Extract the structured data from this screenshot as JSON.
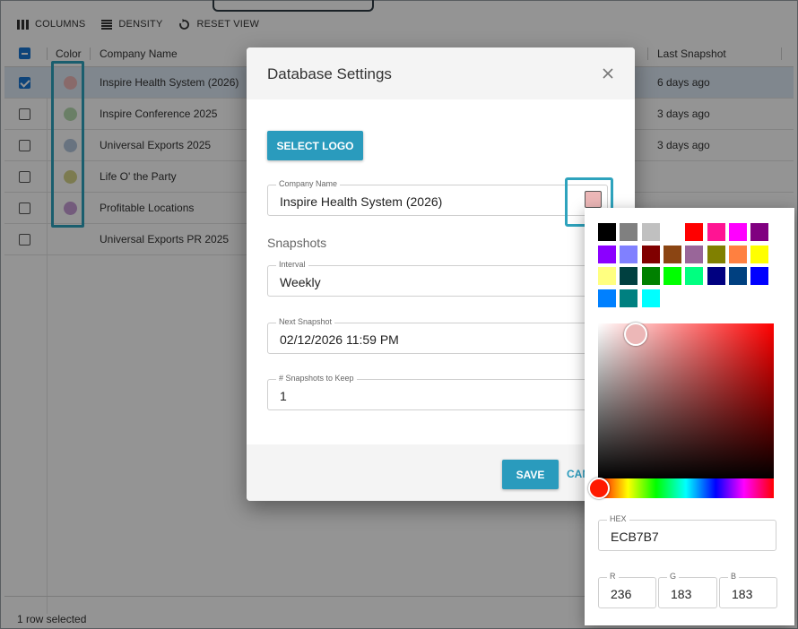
{
  "toolbar": {
    "columns_label": "COLUMNS",
    "density_label": "DENSITY",
    "reset_view_label": "RESET VIEW"
  },
  "grid": {
    "headers": {
      "color": "Color",
      "company_name": "Company Name",
      "last_snapshot": "Last Snapshot"
    },
    "rows": [
      {
        "name": "Inspire Health System (2026)",
        "color": "#ecb7b7",
        "last_snapshot": "6 days ago",
        "selected": true
      },
      {
        "name": "Inspire Conference 2025",
        "color": "#b7dbb0",
        "last_snapshot": "3 days ago",
        "selected": false
      },
      {
        "name": "Universal Exports 2025",
        "color": "#b4c6dc",
        "last_snapshot": "3 days ago",
        "selected": false
      },
      {
        "name": "Life O' the Party",
        "color": "#d6d48a",
        "last_snapshot": "",
        "selected": false
      },
      {
        "name": "Profitable Locations",
        "color": "#c79ed6",
        "last_snapshot": "",
        "selected": false
      },
      {
        "name": "Universal Exports PR 2025",
        "color": "",
        "last_snapshot": "",
        "selected": false
      }
    ],
    "footer": "1 row selected"
  },
  "dialog": {
    "title": "Database Settings",
    "select_logo_label": "SELECT LOGO",
    "company_name_label": "Company Name",
    "company_name_value": "Inspire Health System (2026)",
    "company_color": "#ecb7b7",
    "snapshots_section": "Snapshots",
    "interval_label": "Interval",
    "interval_value": "Weekly",
    "next_snapshot_label": "Next Snapshot",
    "next_snapshot_value": "02/12/2026 11:59 PM",
    "keep_label": "# Snapshots to Keep",
    "keep_value": "1",
    "save_label": "SAVE",
    "cancel_label": "CAN"
  },
  "picker": {
    "presets": [
      "#000000",
      "#808080",
      "#c0c0c0",
      "#ffffff",
      "#ff0000",
      "#ff1493",
      "#ff00ff",
      "#800080",
      "#8b00ff",
      "#8080ff",
      "#800000",
      "#8b4513",
      "#996699",
      "#808000",
      "#ff8040",
      "#ffff00",
      "#ffff80",
      "#004040",
      "#008000",
      "#00ff00",
      "#00ff80",
      "#000080",
      "#004080",
      "#0000ff",
      "#0080ff",
      "#008080",
      "#00ffff"
    ],
    "hex_label": "HEX",
    "hex_value": "ECB7B7",
    "r_label": "R",
    "r_value": "236",
    "g_label": "G",
    "g_value": "183",
    "b_label": "B",
    "b_value": "183"
  },
  "colors": {
    "accent": "#2a9bbd",
    "highlight": "#2ea3bd",
    "selection": "#1976d2"
  }
}
